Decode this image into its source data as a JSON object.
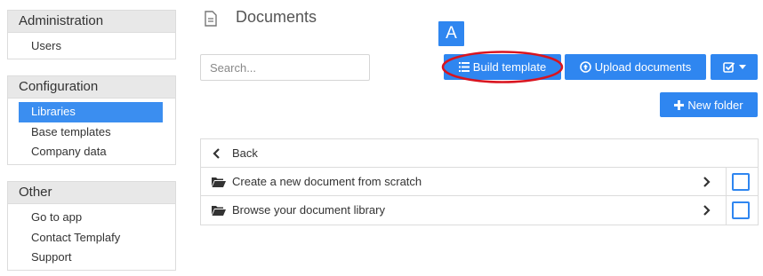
{
  "sidebar": {
    "administration": {
      "title": "Administration",
      "items": [
        "Users"
      ]
    },
    "configuration": {
      "title": "Configuration",
      "items": [
        "Libraries",
        "Base templates",
        "Company data"
      ],
      "active": "Libraries"
    },
    "other": {
      "title": "Other",
      "items": [
        "Go to app",
        "Contact Templafy",
        "Support"
      ]
    }
  },
  "main": {
    "title": "Documents",
    "title_icon": "document-icon",
    "search": {
      "placeholder": "Search..."
    },
    "toolbar": {
      "build_template_label": "Build template",
      "upload_documents_label": "Upload documents",
      "new_folder_label": "New folder",
      "marker_label": "A"
    },
    "list": {
      "back_label": "Back",
      "rows": [
        {
          "label": "Create a new document from scratch"
        },
        {
          "label": "Browse your document library"
        }
      ]
    }
  },
  "colors": {
    "accent": "#2f86f0",
    "active_item": "#3b8ef0",
    "highlight": "#d9141f",
    "panel_header": "#e8e8e8"
  }
}
